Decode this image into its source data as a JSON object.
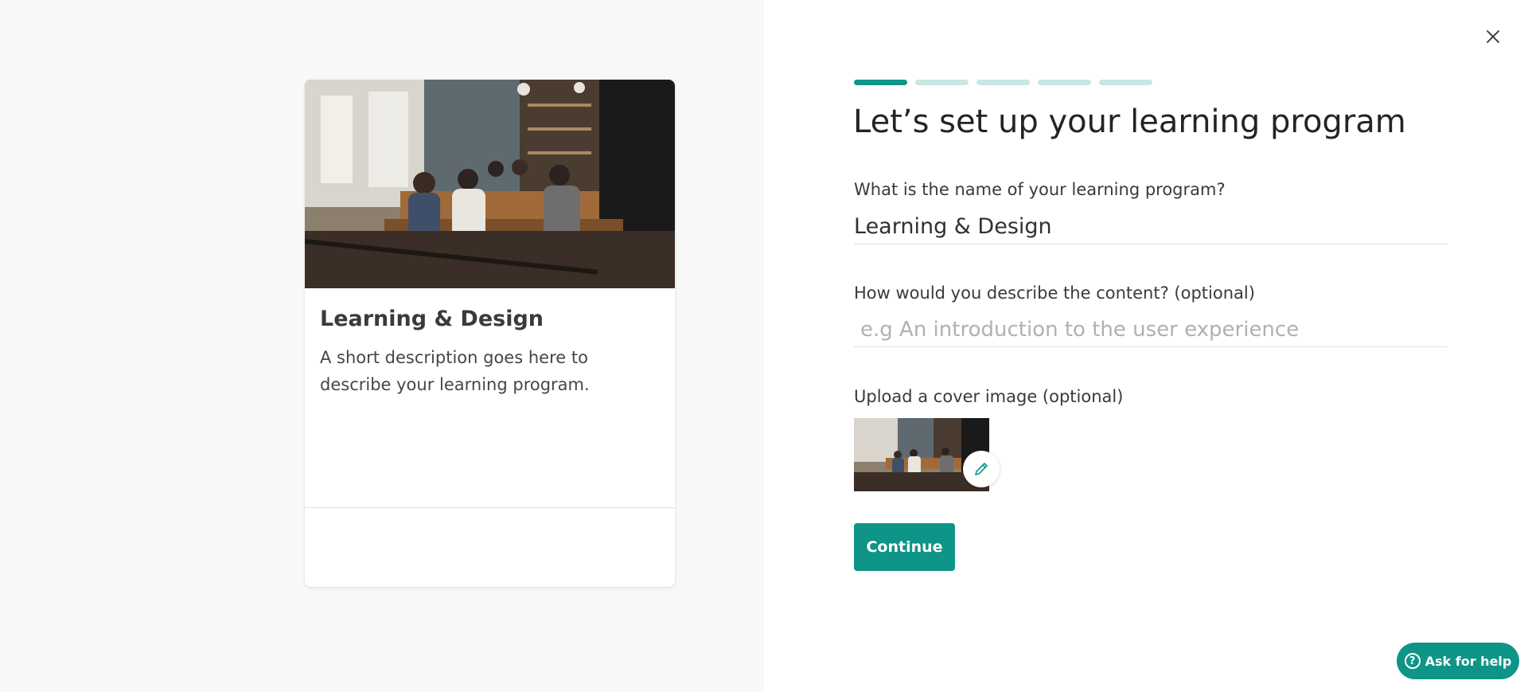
{
  "preview_card": {
    "title": "Learning & Design",
    "description": "A short description goes here to describe your learning program."
  },
  "progress": {
    "total_steps": 5,
    "current_step": 1
  },
  "form": {
    "title": "Let’s set up your learning program",
    "name_label": "What is the name of your learning program?",
    "name_value": "Learning & Design",
    "description_label": "How would you describe the content? (optional)",
    "description_placeholder": "e.g An introduction to the user experience",
    "cover_label": "Upload a cover image (optional)",
    "continue_label": "Continue"
  },
  "help": {
    "label": "Ask for help",
    "icon": "question-circle-icon"
  },
  "icons": {
    "close": "close-icon",
    "edit": "pencil-icon"
  },
  "colors": {
    "accent": "#0f9488",
    "progress_inactive": "#c8e6e3"
  }
}
